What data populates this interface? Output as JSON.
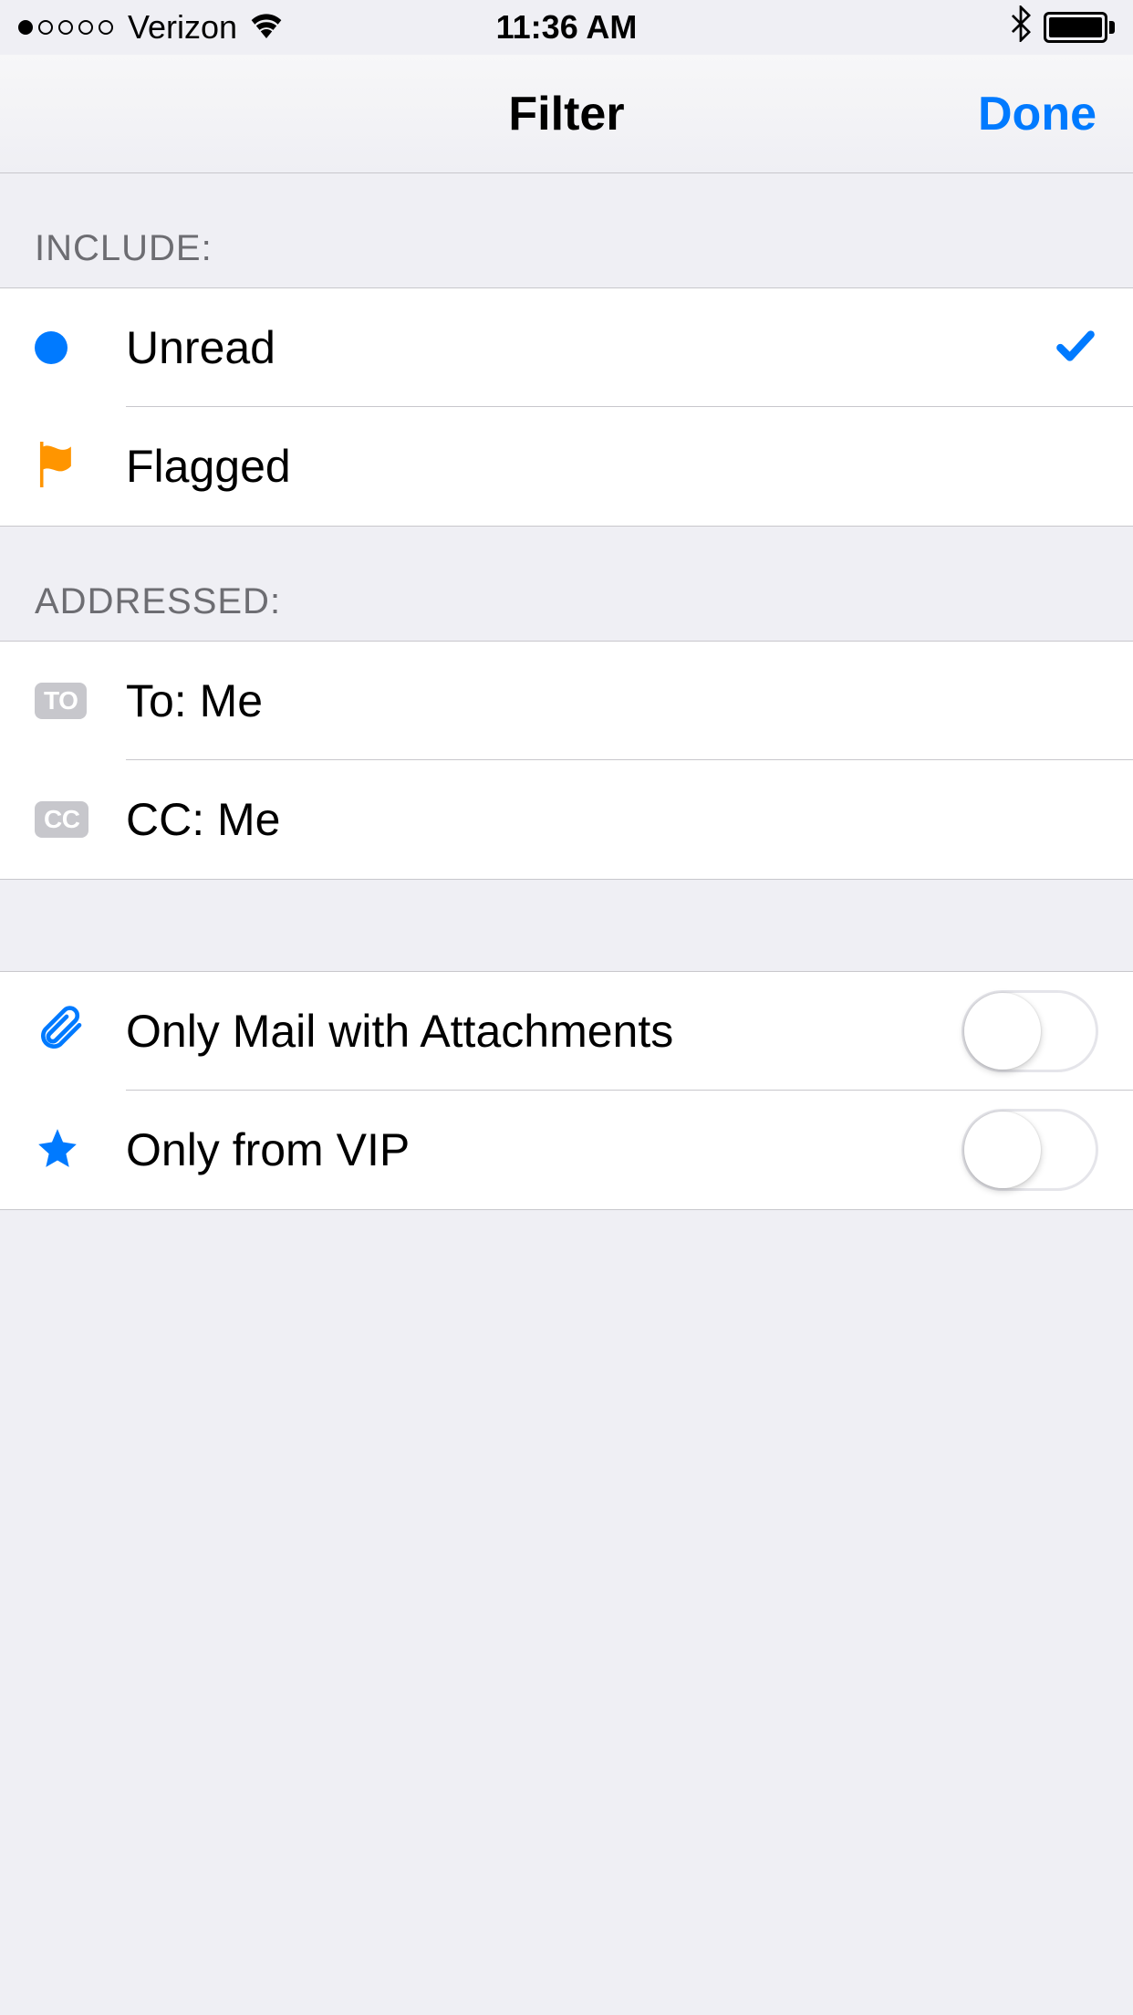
{
  "status": {
    "carrier": "Verizon",
    "time": "11:36 AM"
  },
  "nav": {
    "title": "Filter",
    "done": "Done"
  },
  "sections": {
    "include": {
      "header": "INCLUDE:",
      "unread": "Unread",
      "flagged": "Flagged"
    },
    "addressed": {
      "header": "ADDRESSED:",
      "to_badge": "TO",
      "to_label": "To: Me",
      "cc_badge": "CC",
      "cc_label": "CC: Me"
    },
    "options": {
      "attachments": "Only Mail with Attachments",
      "vip": "Only from VIP"
    }
  }
}
